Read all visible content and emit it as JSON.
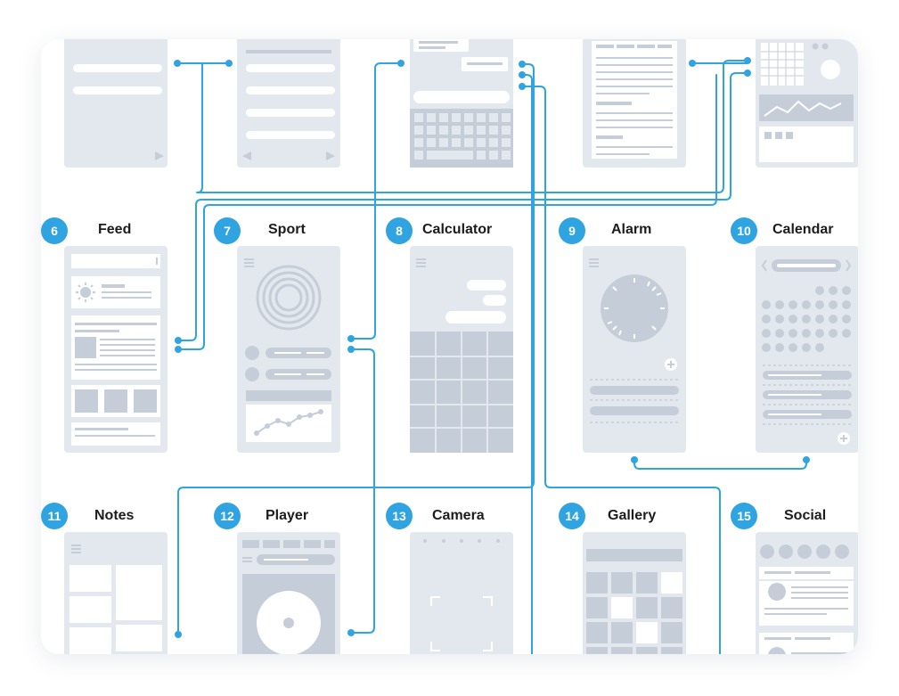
{
  "screens": [
    {
      "number": "6",
      "title": "Feed"
    },
    {
      "number": "7",
      "title": "Sport"
    },
    {
      "number": "8",
      "title": "Calculator"
    },
    {
      "number": "9",
      "title": "Alarm"
    },
    {
      "number": "10",
      "title": "Calendar"
    },
    {
      "number": "11",
      "title": "Notes"
    },
    {
      "number": "12",
      "title": "Player"
    },
    {
      "number": "13",
      "title": "Camera"
    },
    {
      "number": "14",
      "title": "Gallery"
    },
    {
      "number": "15",
      "title": "Social"
    }
  ],
  "colors": {
    "accent": "#2fa4e0",
    "screen_fill": "#e3e8ee",
    "element_fill": "#c5ced8",
    "card_background": "#ffffff"
  }
}
